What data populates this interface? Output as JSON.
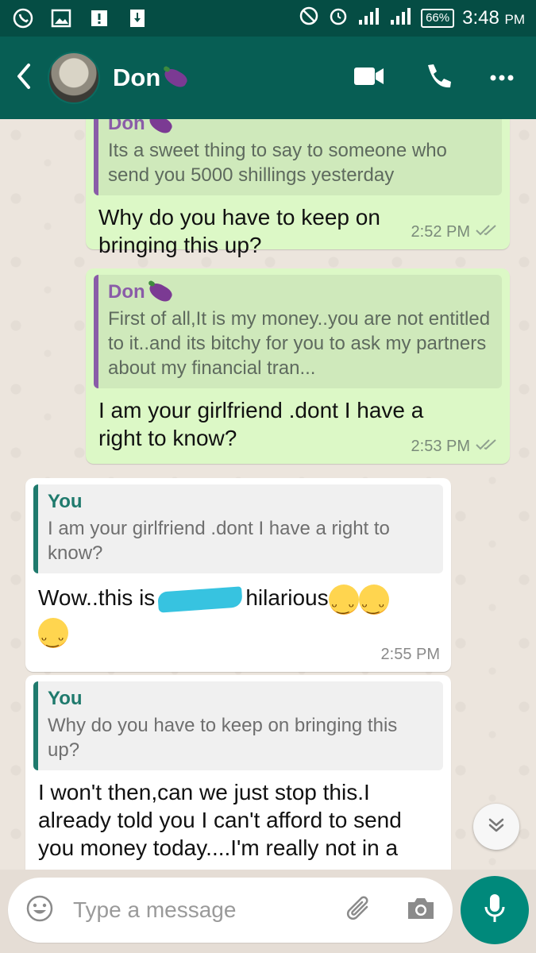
{
  "status_bar": {
    "battery": "66%",
    "time": "3:48",
    "ampm": "PM"
  },
  "header": {
    "contact_name": "Don",
    "icons": [
      "back-arrow-icon",
      "video-call-icon",
      "phone-icon",
      "more-options-icon"
    ]
  },
  "messages": [
    {
      "direction": "outgoing",
      "quote_author": "Don",
      "quote_text": "Its a sweet thing to say to someone who send you 5000 shillings yesterday",
      "text": "Why do you have to keep on bringing this up?",
      "time": "2:52 PM"
    },
    {
      "direction": "outgoing",
      "quote_author": "Don",
      "quote_text": "First of all,It is my money..you are not entitled to it..and its bitchy for you to ask my partners about my financial tran...",
      "text": "I am your girlfriend .dont I have a right to know?",
      "time": "2:53 PM"
    },
    {
      "direction": "incoming",
      "quote_author": "You",
      "quote_text": "I am your girlfriend .dont I have a right to know?",
      "text_before": "Wow..this is",
      "text_after": "hilarious",
      "time": "2:55 PM"
    },
    {
      "direction": "incoming",
      "quote_author": "You",
      "quote_text": "Why do you have to keep on bringing this up?",
      "text": "I won't then,can we just stop this.I already told you I can't afford to send you money today....I'm really not in a"
    }
  ],
  "composer": {
    "placeholder": "Type a message"
  },
  "colors": {
    "header": "#075e54",
    "outgoing_bubble": "#dcf8c6",
    "incoming_bubble": "#ffffff",
    "accent": "#00897b"
  }
}
